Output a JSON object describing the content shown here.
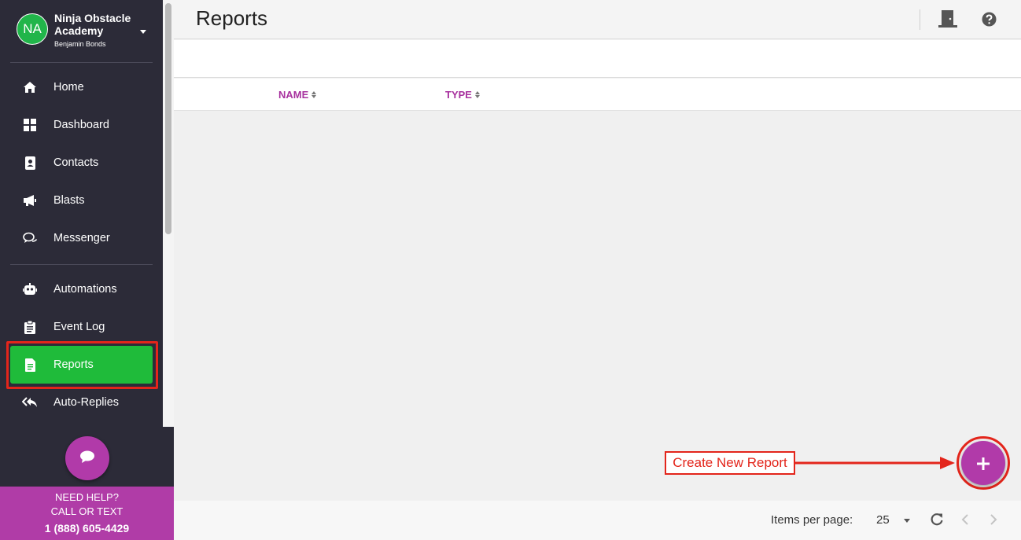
{
  "sidebar": {
    "org_avatar": "NA",
    "org_name": "Ninja Obstacle Academy",
    "user_name": "Benjamin Bonds",
    "items": [
      {
        "label": "Home",
        "icon": "home-icon"
      },
      {
        "label": "Dashboard",
        "icon": "grid-icon"
      },
      {
        "label": "Contacts",
        "icon": "contact-card-icon"
      },
      {
        "label": "Blasts",
        "icon": "megaphone-icon"
      },
      {
        "label": "Messenger",
        "icon": "chat-bubbles-icon"
      },
      {
        "label": "Automations",
        "icon": "robot-icon"
      },
      {
        "label": "Event Log",
        "icon": "clipboard-icon"
      },
      {
        "label": "Reports",
        "icon": "report-file-icon",
        "active": true
      },
      {
        "label": "Auto-Replies",
        "icon": "reply-all-icon"
      }
    ],
    "help": {
      "line1": "NEED HELP?",
      "line2": "CALL OR TEXT",
      "phone": "1 (888) 605-4429"
    }
  },
  "header": {
    "title": "Reports"
  },
  "table": {
    "columns": [
      "NAME",
      "TYPE"
    ]
  },
  "footer": {
    "items_per_page_label": "Items per page:",
    "items_per_page_value": "25"
  },
  "annotation": {
    "callout": "Create New Report"
  },
  "colors": {
    "accent": "#b13aa9",
    "active_nav": "#1fbb3a",
    "annotation": "#e3251b",
    "sidebar_bg": "#2c2b38"
  }
}
